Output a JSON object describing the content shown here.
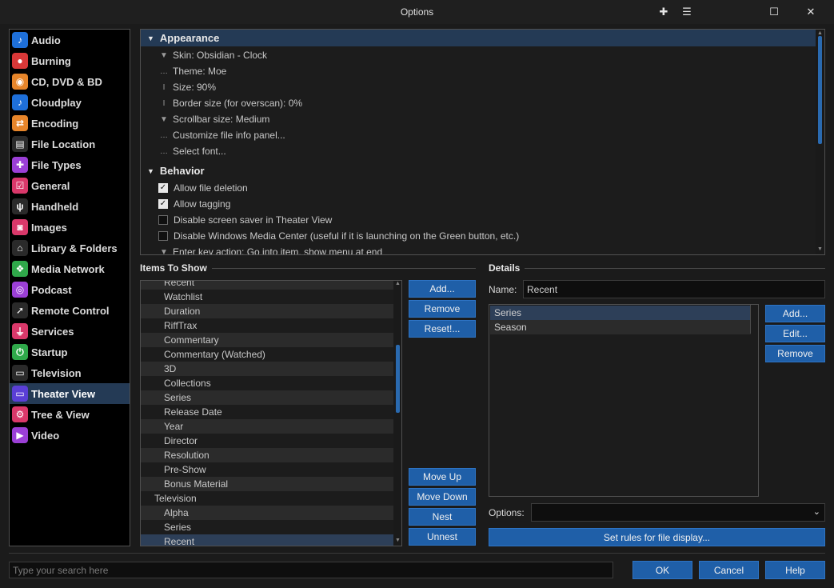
{
  "window": {
    "title": "Options",
    "controls": [
      "pin-icon",
      "restore-icon",
      "maximize-icon",
      "close-icon"
    ]
  },
  "sidebar": {
    "items": [
      {
        "label": "Audio",
        "icon": "music-note-icon",
        "color": "#1e6fd9",
        "glyph": "♪"
      },
      {
        "label": "Burning",
        "icon": "disc-burn-icon",
        "color": "#d93838",
        "glyph": "●"
      },
      {
        "label": "CD, DVD & BD",
        "icon": "disc-icon",
        "color": "#e6852a",
        "glyph": "◉"
      },
      {
        "label": "Cloudplay",
        "icon": "music-note-icon",
        "color": "#1e6fd9",
        "glyph": "♪"
      },
      {
        "label": "Encoding",
        "icon": "convert-icon",
        "color": "#e6852a",
        "glyph": "⇄"
      },
      {
        "label": "File Location",
        "icon": "file-search-icon",
        "color": "#2a2a2a",
        "glyph": "▤"
      },
      {
        "label": "File Types",
        "icon": "puzzle-icon",
        "color": "#9b3fd6",
        "glyph": "✚"
      },
      {
        "label": "General",
        "icon": "checkbox-icon",
        "color": "#d9386a",
        "glyph": "☑"
      },
      {
        "label": "Handheld",
        "icon": "usb-icon",
        "color": "#2a2a2a",
        "glyph": "ψ"
      },
      {
        "label": "Images",
        "icon": "camera-icon",
        "color": "#d9386a",
        "glyph": "◙"
      },
      {
        "label": "Library & Folders",
        "icon": "home-icon",
        "color": "#2a2a2a",
        "glyph": "⌂"
      },
      {
        "label": "Media Network",
        "icon": "network-icon",
        "color": "#2fa84a",
        "glyph": "❖"
      },
      {
        "label": "Podcast",
        "icon": "podcast-icon",
        "color": "#9b3fd6",
        "glyph": "◎"
      },
      {
        "label": "Remote Control",
        "icon": "remote-icon",
        "color": "#2a2a2a",
        "glyph": "➚"
      },
      {
        "label": "Services",
        "icon": "plug-icon",
        "color": "#d9386a",
        "glyph": "⏚"
      },
      {
        "label": "Startup",
        "icon": "power-icon",
        "color": "#2fa84a",
        "glyph": "⏻"
      },
      {
        "label": "Television",
        "icon": "monitor-icon",
        "color": "#2a2a2a",
        "glyph": "▭"
      },
      {
        "label": "Theater View",
        "icon": "tv-icon",
        "color": "#5a3fd6",
        "glyph": "▭"
      },
      {
        "label": "Tree & View",
        "icon": "gear-icon",
        "color": "#d9386a",
        "glyph": "⚙"
      },
      {
        "label": "Video",
        "icon": "video-camera-icon",
        "color": "#9b3fd6",
        "glyph": "▶"
      }
    ],
    "selected": "Theater View"
  },
  "tree": {
    "appearance": {
      "label": "Appearance",
      "rows": [
        {
          "label": "Skin: Obsidian - Clock",
          "icon": "dropdown-icon",
          "glyph": "▼"
        },
        {
          "label": "Theme: Moe",
          "icon": "ellipsis-icon",
          "glyph": "…"
        },
        {
          "label": "Size: 90%",
          "icon": "ibeam-icon",
          "glyph": "I"
        },
        {
          "label": "Border size (for overscan): 0%",
          "icon": "ibeam-icon",
          "glyph": "I"
        },
        {
          "label": "Scrollbar size: Medium",
          "icon": "dropdown-icon",
          "glyph": "▼"
        },
        {
          "label": "Customize file info panel...",
          "icon": "ellipsis-icon",
          "glyph": "…"
        },
        {
          "label": "Select font...",
          "icon": "ellipsis-icon",
          "glyph": "…"
        }
      ]
    },
    "behavior": {
      "label": "Behavior",
      "rows": [
        {
          "label": "Allow file deletion",
          "checked": true
        },
        {
          "label": "Allow tagging",
          "checked": true
        },
        {
          "label": "Disable screen saver in Theater View",
          "checked": false
        },
        {
          "label": "Disable Windows Media Center (useful if it is launching on the Green button, etc.)",
          "checked": false
        },
        {
          "label": "Enter key action: Go into item, show menu at end",
          "icon": "dropdown-icon",
          "glyph": "▼"
        }
      ]
    }
  },
  "items_to_show": {
    "title": "Items To Show",
    "items": [
      {
        "label": "Recent",
        "indent": 2
      },
      {
        "label": "Watchlist",
        "indent": 2
      },
      {
        "label": "Duration",
        "indent": 2
      },
      {
        "label": "RiffTrax",
        "indent": 2
      },
      {
        "label": "Commentary",
        "indent": 2
      },
      {
        "label": "Commentary (Watched)",
        "indent": 2
      },
      {
        "label": "3D",
        "indent": 2
      },
      {
        "label": "Collections",
        "indent": 2
      },
      {
        "label": "Series",
        "indent": 2
      },
      {
        "label": "Release Date",
        "indent": 2
      },
      {
        "label": "Year",
        "indent": 2
      },
      {
        "label": "Director",
        "indent": 2
      },
      {
        "label": "Resolution",
        "indent": 2
      },
      {
        "label": "Pre-Show",
        "indent": 2
      },
      {
        "label": "Bonus Material",
        "indent": 2
      },
      {
        "label": "Television",
        "indent": 1
      },
      {
        "label": "Alpha",
        "indent": 2
      },
      {
        "label": "Series",
        "indent": 2
      },
      {
        "label": "Recent",
        "indent": 2
      }
    ],
    "selected_index": 18,
    "buttons": {
      "add": "Add...",
      "remove": "Remove",
      "reset": "Reset!...",
      "move_up": "Move Up",
      "move_down": "Move Down",
      "nest": "Nest",
      "unnest": "Unnest"
    }
  },
  "details": {
    "title": "Details",
    "name_label": "Name:",
    "name_value": "Recent",
    "list": [
      "Series",
      "Season"
    ],
    "buttons": {
      "add": "Add...",
      "edit": "Edit...",
      "remove": "Remove"
    },
    "options_label": "Options:",
    "options_value": "",
    "rules_button": "Set rules for file display..."
  },
  "footer": {
    "search_placeholder": "Type your search here",
    "ok": "OK",
    "cancel": "Cancel",
    "help": "Help"
  },
  "colors": {
    "accent": "#1f5fa8",
    "selection": "#243a55",
    "background": "#1b1b1b"
  }
}
